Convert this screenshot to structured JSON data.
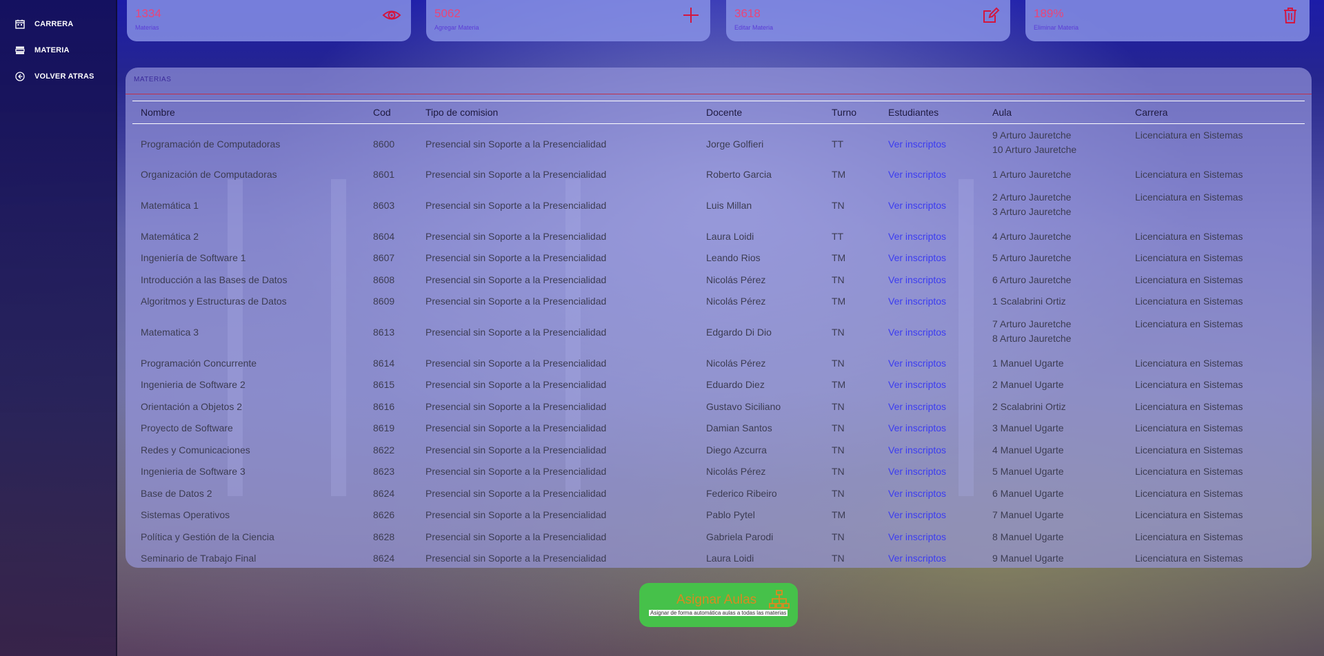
{
  "colors": {
    "accent_icon": "#d3163f",
    "card_number": "#e9457a",
    "link": "#3c3cf0",
    "button_bg": "#46c14a",
    "button_text": "#d98a20"
  },
  "sidebar": {
    "items": [
      {
        "label": "CARRERA",
        "icon": "calendar-icon"
      },
      {
        "label": "MATERIA",
        "icon": "list-icon"
      },
      {
        "label": "VOLVER ATRAS",
        "icon": "back-arrow-icon"
      }
    ]
  },
  "cards": [
    {
      "number": "1334",
      "label": "Materias",
      "icon": "eye-icon"
    },
    {
      "number": "5062",
      "label": "Agregar Materia",
      "icon": "plus-icon"
    },
    {
      "number": "3618",
      "label": "Editar Materia",
      "icon": "edit-icon"
    },
    {
      "number": "189%",
      "label": "Eliminar Materia",
      "icon": "trash-icon"
    }
  ],
  "panel": {
    "title": "MATERIAS",
    "columns": {
      "nombre": "Nombre",
      "cod": "Cod",
      "tipo": "Tipo de comision",
      "docente": "Docente",
      "turno": "Turno",
      "estudiantes": "Estudiantes",
      "aula": "Aula",
      "carrera": "Carrera"
    },
    "rows": [
      {
        "nombre": "Programación de Computadoras",
        "cod": "8600",
        "tipo": "Presencial sin Soporte a la Presencialidad",
        "docente": "Jorge Golfieri",
        "turno": "TT",
        "estudiantes": "Ver inscriptos",
        "aula1": "9 Arturo Jauretche",
        "aula2": "10 Arturo Jauretche",
        "carrera": "Licenciatura en Sistemas"
      },
      {
        "nombre": "Organización de Computadoras",
        "cod": "8601",
        "tipo": "Presencial sin Soporte a la Presencialidad",
        "docente": "Roberto Garcia",
        "turno": "TM",
        "estudiantes": "Ver inscriptos",
        "aula1": "1 Arturo Jauretche",
        "aula2": "",
        "carrera": "Licenciatura en Sistemas"
      },
      {
        "nombre": "Matemática 1",
        "cod": "8603",
        "tipo": "Presencial sin Soporte a la Presencialidad",
        "docente": "Luis Millan",
        "turno": "TN",
        "estudiantes": "Ver inscriptos",
        "aula1": "2 Arturo Jauretche",
        "aula2": "3 Arturo Jauretche",
        "carrera": "Licenciatura en Sistemas"
      },
      {
        "nombre": "Matemática 2",
        "cod": "8604",
        "tipo": "Presencial sin Soporte a la Presencialidad",
        "docente": "Laura Loidi",
        "turno": "TT",
        "estudiantes": "Ver inscriptos",
        "aula1": "4 Arturo Jauretche",
        "aula2": "",
        "carrera": "Licenciatura en Sistemas"
      },
      {
        "nombre": "Ingeniería de Software 1",
        "cod": "8607",
        "tipo": "Presencial sin Soporte a la Presencialidad",
        "docente": "Leando Rios",
        "turno": "TM",
        "estudiantes": "Ver inscriptos",
        "aula1": "5 Arturo Jauretche",
        "aula2": "",
        "carrera": "Licenciatura en Sistemas"
      },
      {
        "nombre": "Introducción a las Bases de Datos",
        "cod": "8608",
        "tipo": "Presencial sin Soporte a la Presencialidad",
        "docente": "Nicolás Pérez",
        "turno": "TN",
        "estudiantes": "Ver inscriptos",
        "aula1": "6 Arturo Jauretche",
        "aula2": "",
        "carrera": "Licenciatura en Sistemas"
      },
      {
        "nombre": "Algoritmos y Estructuras de Datos",
        "cod": "8609",
        "tipo": "Presencial sin Soporte a la Presencialidad",
        "docente": "Nicolás Pérez",
        "turno": "TM",
        "estudiantes": "Ver inscriptos",
        "aula1": "1 Scalabrini Ortiz",
        "aula2": "",
        "carrera": "Licenciatura en Sistemas"
      },
      {
        "nombre": "Matematica 3",
        "cod": "8613",
        "tipo": "Presencial sin Soporte a la Presencialidad",
        "docente": "Edgardo Di Dio",
        "turno": "TN",
        "estudiantes": "Ver inscriptos",
        "aula1": "7 Arturo Jauretche",
        "aula2": "8 Arturo Jauretche",
        "carrera": "Licenciatura en Sistemas"
      },
      {
        "nombre": "Programación Concurrente",
        "cod": "8614",
        "tipo": "Presencial sin Soporte a la Presencialidad",
        "docente": "Nicolás Pérez",
        "turno": "TN",
        "estudiantes": "Ver inscriptos",
        "aula1": "1 Manuel Ugarte",
        "aula2": "",
        "carrera": "Licenciatura en Sistemas"
      },
      {
        "nombre": "Ingenieria de Software 2",
        "cod": "8615",
        "tipo": "Presencial sin Soporte a la Presencialidad",
        "docente": "Eduardo Diez",
        "turno": "TM",
        "estudiantes": "Ver inscriptos",
        "aula1": "2 Manuel Ugarte",
        "aula2": "",
        "carrera": "Licenciatura en Sistemas"
      },
      {
        "nombre": "Orientación a Objetos 2",
        "cod": "8616",
        "tipo": "Presencial sin Soporte a la Presencialidad",
        "docente": "Gustavo Siciliano",
        "turno": "TN",
        "estudiantes": "Ver inscriptos",
        "aula1": "2 Scalabrini Ortiz",
        "aula2": "",
        "carrera": "Licenciatura en Sistemas"
      },
      {
        "nombre": "Proyecto de Software",
        "cod": "8619",
        "tipo": "Presencial sin Soporte a la Presencialidad",
        "docente": "Damian Santos",
        "turno": "TN",
        "estudiantes": "Ver inscriptos",
        "aula1": "3 Manuel Ugarte",
        "aula2": "",
        "carrera": "Licenciatura en Sistemas"
      },
      {
        "nombre": "Redes y Comunicaciones",
        "cod": "8622",
        "tipo": "Presencial sin Soporte a la Presencialidad",
        "docente": "Diego Azcurra",
        "turno": "TN",
        "estudiantes": "Ver inscriptos",
        "aula1": "4 Manuel Ugarte",
        "aula2": "",
        "carrera": "Licenciatura en Sistemas"
      },
      {
        "nombre": "Ingenieria de Software 3",
        "cod": "8623",
        "tipo": "Presencial sin Soporte a la Presencialidad",
        "docente": "Nicolás Pérez",
        "turno": "TN",
        "estudiantes": "Ver inscriptos",
        "aula1": "5 Manuel Ugarte",
        "aula2": "",
        "carrera": "Licenciatura en Sistemas"
      },
      {
        "nombre": "Base de Datos 2",
        "cod": "8624",
        "tipo": "Presencial sin Soporte a la Presencialidad",
        "docente": "Federico Ribeiro",
        "turno": "TN",
        "estudiantes": "Ver inscriptos",
        "aula1": "6 Manuel Ugarte",
        "aula2": "",
        "carrera": "Licenciatura en Sistemas"
      },
      {
        "nombre": "Sistemas Operativos",
        "cod": "8626",
        "tipo": "Presencial sin Soporte a la Presencialidad",
        "docente": "Pablo Pytel",
        "turno": "TM",
        "estudiantes": "Ver inscriptos",
        "aula1": "7 Manuel Ugarte",
        "aula2": "",
        "carrera": "Licenciatura en Sistemas"
      },
      {
        "nombre": "Política y Gestión de la Ciencia",
        "cod": "8628",
        "tipo": "Presencial sin Soporte a la Presencialidad",
        "docente": "Gabriela Parodi",
        "turno": "TN",
        "estudiantes": "Ver inscriptos",
        "aula1": "8 Manuel Ugarte",
        "aula2": "",
        "carrera": "Licenciatura en Sistemas"
      },
      {
        "nombre": "Seminario de Trabajo Final",
        "cod": "8624",
        "tipo": "Presencial sin Soporte a la Presencialidad",
        "docente": "Laura Loidi",
        "turno": "TN",
        "estudiantes": "Ver inscriptos",
        "aula1": "9 Manuel Ugarte",
        "aula2": "",
        "carrera": "Licenciatura en Sistemas"
      }
    ]
  },
  "assign_button": {
    "label": "Asignar Aulas",
    "hint": "Asignar de forma automática aulas a todas las materias",
    "icon": "sitemap-icon"
  }
}
